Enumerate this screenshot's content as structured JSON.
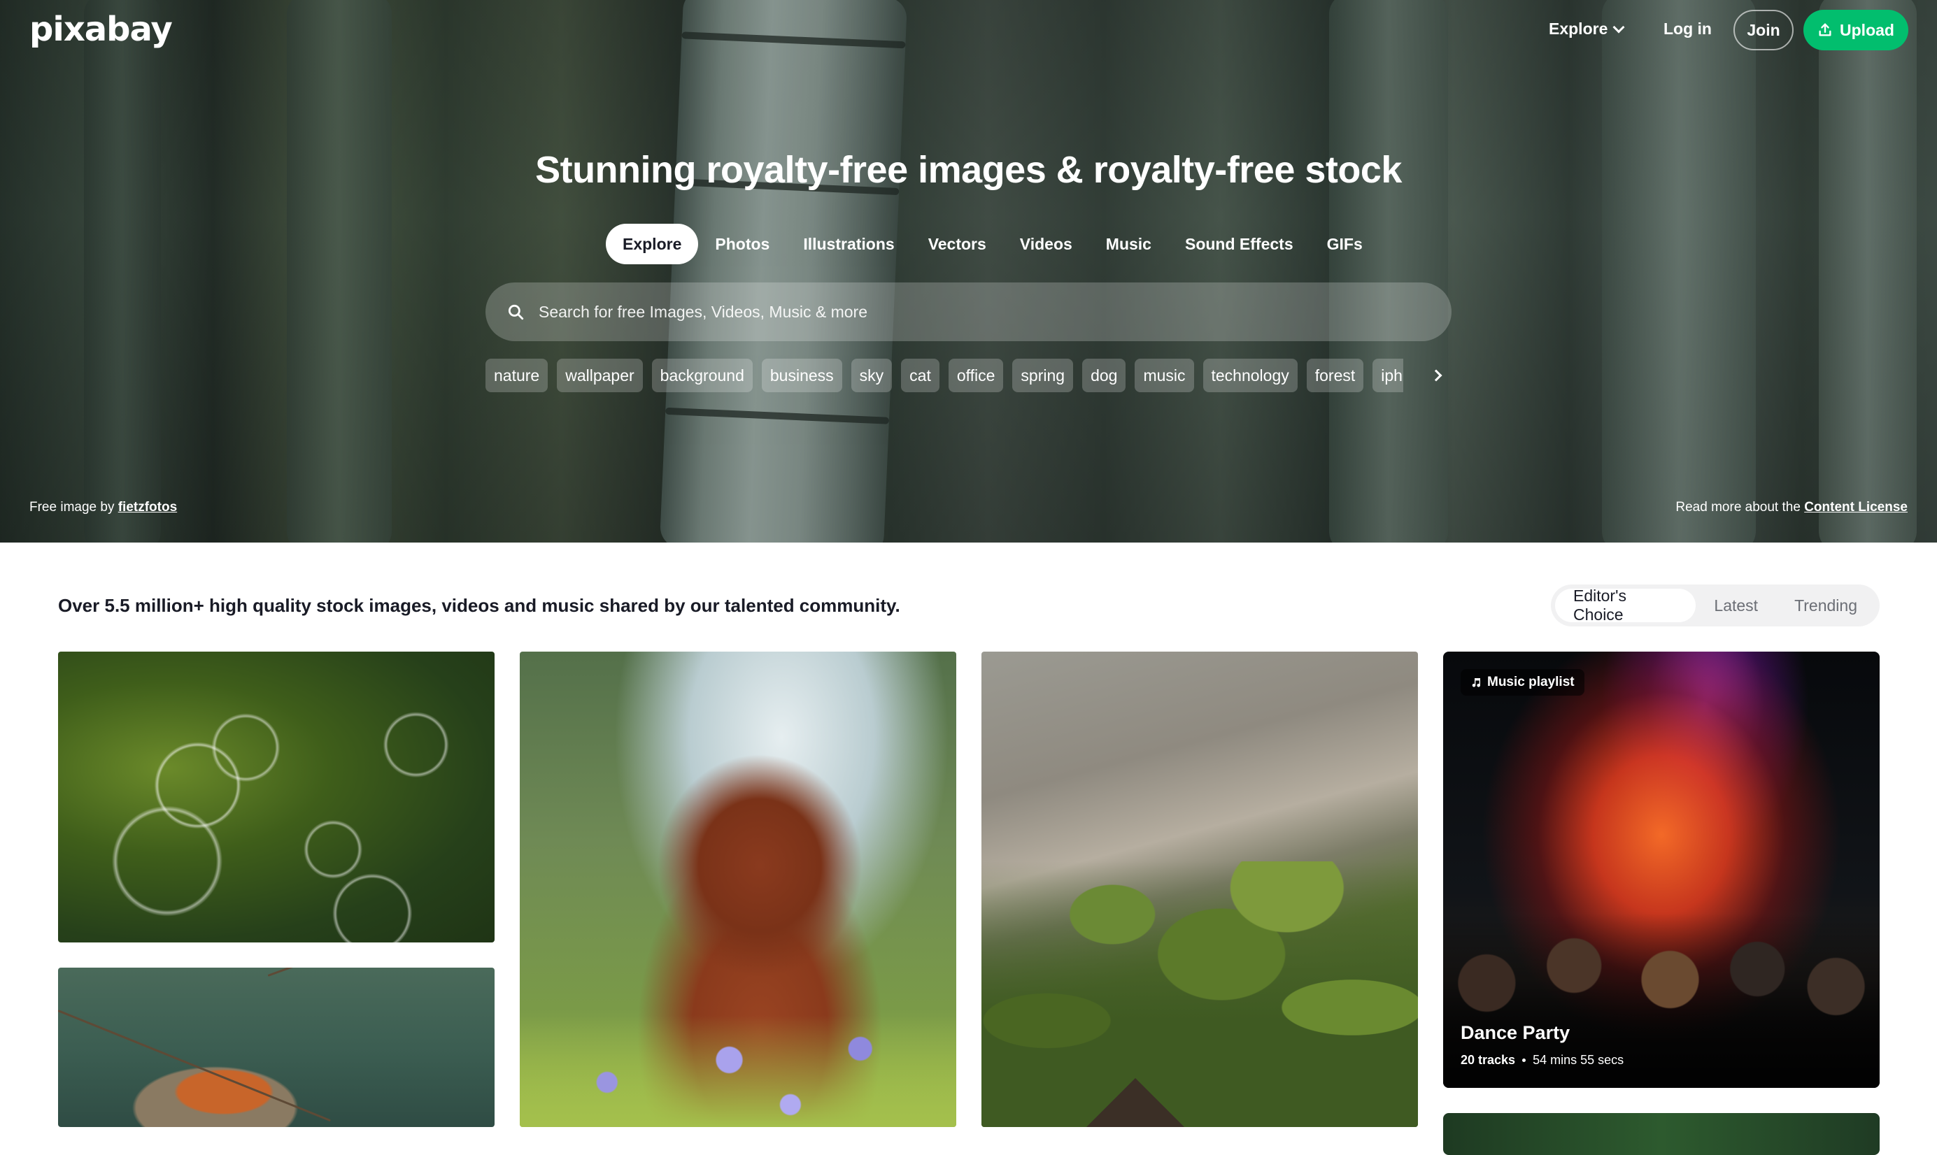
{
  "header": {
    "logo": "pixabay",
    "explore_label": "Explore",
    "login_label": "Log in",
    "join_label": "Join",
    "upload_label": "Upload",
    "upload_color": "#02be6e"
  },
  "hero": {
    "headline": "Stunning royalty-free images & royalty-free stock",
    "tabs": [
      {
        "label": "Explore",
        "active": true
      },
      {
        "label": "Photos"
      },
      {
        "label": "Illustrations"
      },
      {
        "label": "Vectors"
      },
      {
        "label": "Videos"
      },
      {
        "label": "Music"
      },
      {
        "label": "Sound Effects"
      },
      {
        "label": "GIFs"
      }
    ],
    "search_placeholder": "Search for free Images, Videos, Music & more",
    "tags": [
      "nature",
      "wallpaper",
      "background",
      "business",
      "sky",
      "cat",
      "office",
      "spring",
      "dog",
      "music",
      "technology",
      "forest",
      "iphone"
    ],
    "credit_prefix": "Free image by",
    "credit_author": "fietzfotos",
    "license_prefix": "Read more about the",
    "license_link": "Content License"
  },
  "main": {
    "tagline": "Over 5.5 million+ high quality stock images, videos and music shared by our talented community.",
    "filters": [
      {
        "label": "Editor's Choice",
        "active": true
      },
      {
        "label": "Latest"
      },
      {
        "label": "Trending"
      }
    ],
    "playlist": {
      "badge": "Music playlist",
      "title": "Dance Party",
      "tracks": "20 tracks",
      "duration": "54 mins 55 secs"
    }
  }
}
